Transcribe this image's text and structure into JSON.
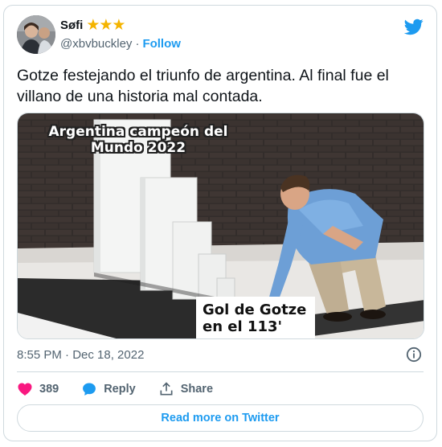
{
  "author": {
    "display_name": "Søfi",
    "badge_stars": "★★★",
    "handle": "@xbvbuckley",
    "separator": "·",
    "follow_label": "Follow"
  },
  "tweet": {
    "text": "Gotze festejando el triunfo de argentina. Al final fue el villano de una historia mal contada.",
    "timestamp": "8:55 PM · Dec 18, 2022"
  },
  "media": {
    "top_caption": "Argentina campeón del Mundo 2022",
    "bottom_caption": "Gol de Gotze en el 113'"
  },
  "actions": {
    "like_count": "389",
    "reply_label": "Reply",
    "share_label": "Share"
  },
  "read_more_label": "Read more on Twitter",
  "colors": {
    "twitter_blue": "#1d9bf0",
    "like_pink": "#f91880",
    "secondary_text": "#536471",
    "border": "#cfd9de"
  }
}
